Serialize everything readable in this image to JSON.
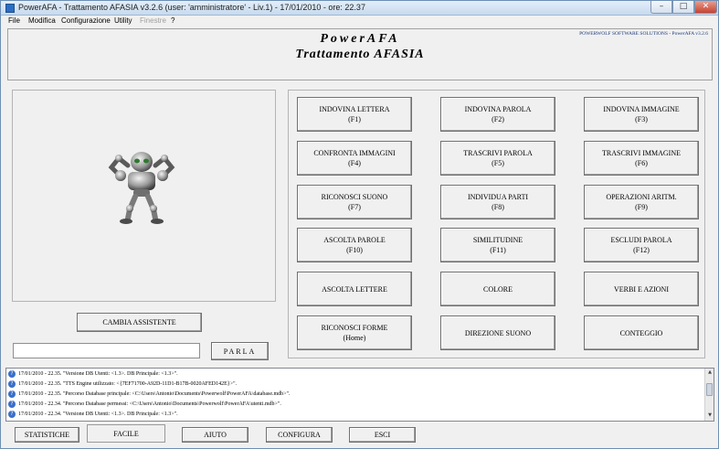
{
  "window": {
    "title": "PowerAFA - Trattamento AFASIA v3.2.6  (user: 'amministratore'  - Liv.1) - 17/01/2010 - ore: 22.37",
    "min_glyph": "–",
    "max_glyph": "□",
    "close_glyph": "✕"
  },
  "menu": {
    "file": "File",
    "modifica": "Modifica",
    "configurazione": "Configurazione",
    "utility": "Utility",
    "finestre": "Finestre",
    "help": "?"
  },
  "header": {
    "title1": "PowerAFA",
    "title2": "Trattamento AFASIA",
    "company": "POWERWOLF SOFTWARE SOLUTIONS - PowerAFA v3.2.6"
  },
  "assistant": {
    "change_label": "CAMBIA ASSISTENTE",
    "input_value": "",
    "speak_label": "PARLA"
  },
  "exercises": [
    {
      "label": "INDOVINA LETTERA",
      "key": "(F1)"
    },
    {
      "label": "INDOVINA PAROLA",
      "key": "(F2)"
    },
    {
      "label": "INDOVINA IMMAGINE",
      "key": "(F3)"
    },
    {
      "label": "CONFRONTA IMMAGINI",
      "key": "(F4)"
    },
    {
      "label": "TRASCRIVI PAROLA",
      "key": "(F5)"
    },
    {
      "label": "TRASCRIVI IMMAGINE",
      "key": "(F6)"
    },
    {
      "label": "RICONOSCI SUONO",
      "key": "(F7)"
    },
    {
      "label": "INDIVIDUA PARTI",
      "key": "(F8)"
    },
    {
      "label": "OPERAZIONI ARITM.",
      "key": "(F9)"
    },
    {
      "label": "ASCOLTA PAROLE",
      "key": "(F10)"
    },
    {
      "label": "SIMILITUDINE",
      "key": "(F11)"
    },
    {
      "label": "ESCLUDI PAROLA",
      "key": "(F12)"
    },
    {
      "label": "ASCOLTA LETTERE",
      "key": ""
    },
    {
      "label": "COLORE",
      "key": ""
    },
    {
      "label": "VERBI E AZIONI",
      "key": ""
    },
    {
      "label": "RICONOSCI FORME",
      "key": "(Home)"
    },
    {
      "label": "DIREZIONE SUONO",
      "key": ""
    },
    {
      "label": "CONTEGGIO",
      "key": ""
    }
  ],
  "log": [
    "17/01/2010 - 22.35. \"Versione DB Utenti: <1.3>. DB Principale: <1.3>\".",
    "17/01/2010 - 22.35. \"TTS Engine utilizzato: <{7EF71700-A92D-11D1-B17B-0020AFED142E}>\".",
    "17/01/2010 - 22.35. \"Percorso Database principale: <C:\\Users\\Antonio\\Documents\\Powerwolf\\PowerAFA\\database.mdb>\".",
    "17/01/2010 - 22.34. \"Percorso Database permessi: <C:\\Users\\Antonio\\Documents\\Powerwolf\\PowerAFA\\utenti.mdb>\".",
    "17/01/2010 - 22.34. \"Versione DB Utenti: <1.3>. DB Principale: <1.3>\"."
  ],
  "bottom_buttons": {
    "statistiche": "STATISTICHE",
    "facile": "FACILE",
    "aiuto": "AIUTO",
    "configura": "CONFIGURA",
    "esci": "ESCI"
  }
}
